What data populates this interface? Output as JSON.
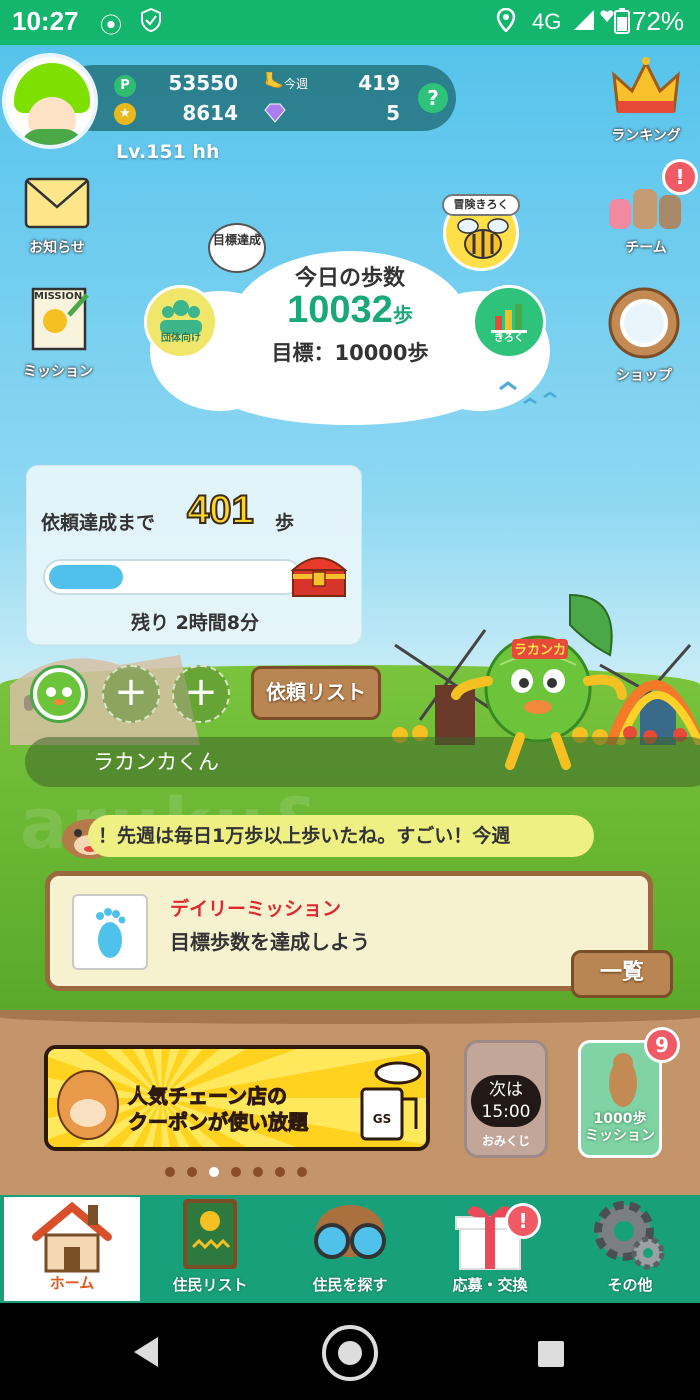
{
  "status_bar": {
    "time": "10:27",
    "network": "4G",
    "battery": "72%"
  },
  "profile": {
    "points": "53550",
    "week_label": "今週",
    "week_value": "419",
    "coins": "8614",
    "gems": "5",
    "level": "Lv.151 hh"
  },
  "side_buttons": {
    "notice": "お知らせ",
    "mission": "ミッション",
    "ranking": "ランキング",
    "team": "チーム",
    "shop": "ショップ",
    "mission_tag": "MISSION"
  },
  "steps": {
    "title": "今日の歩数",
    "value": "10032",
    "unit": "歩",
    "goal": "目標：10000歩",
    "achieved_badge": "目標達成",
    "group_label": "団体向け",
    "record_label": "きろく",
    "adventure_label": "冒険きろく"
  },
  "request": {
    "label": "依頼達成まで",
    "remaining_steps": "401",
    "unit": "歩",
    "progress": 0.3,
    "time_left": "残り 2時間8分",
    "list_button": "依頼リスト"
  },
  "character": {
    "name": "ラカンカくん",
    "sign": "ラカンカ"
  },
  "chat": {
    "message": "！先週は毎日1万歩以上歩いたね。すごい！今週"
  },
  "daily_mission": {
    "title": "デイリーミッション",
    "description": "目標歩数を達成しよう",
    "list_button": "一覧"
  },
  "promos": {
    "banner_line1": "人気チェーン店の",
    "banner_line2": "クーポンが使い放題",
    "omikuji_next": "次は",
    "omikuji_time": "15:00",
    "omikuji_label": "おみくじ",
    "mission1000_line1": "1000歩",
    "mission1000_line2": "ミッション",
    "mission1000_badge": "9",
    "gas_label": "GS"
  },
  "badges": {
    "team": "!",
    "apply": "!"
  },
  "nav": {
    "home": "ホーム",
    "residents": "住民リスト",
    "search": "住民を探す",
    "apply": "応募・交換",
    "other": "その他"
  },
  "colors": {
    "accent_green": "#14b66e",
    "steps_green": "#1aa879",
    "badge_red": "#f05a64"
  }
}
